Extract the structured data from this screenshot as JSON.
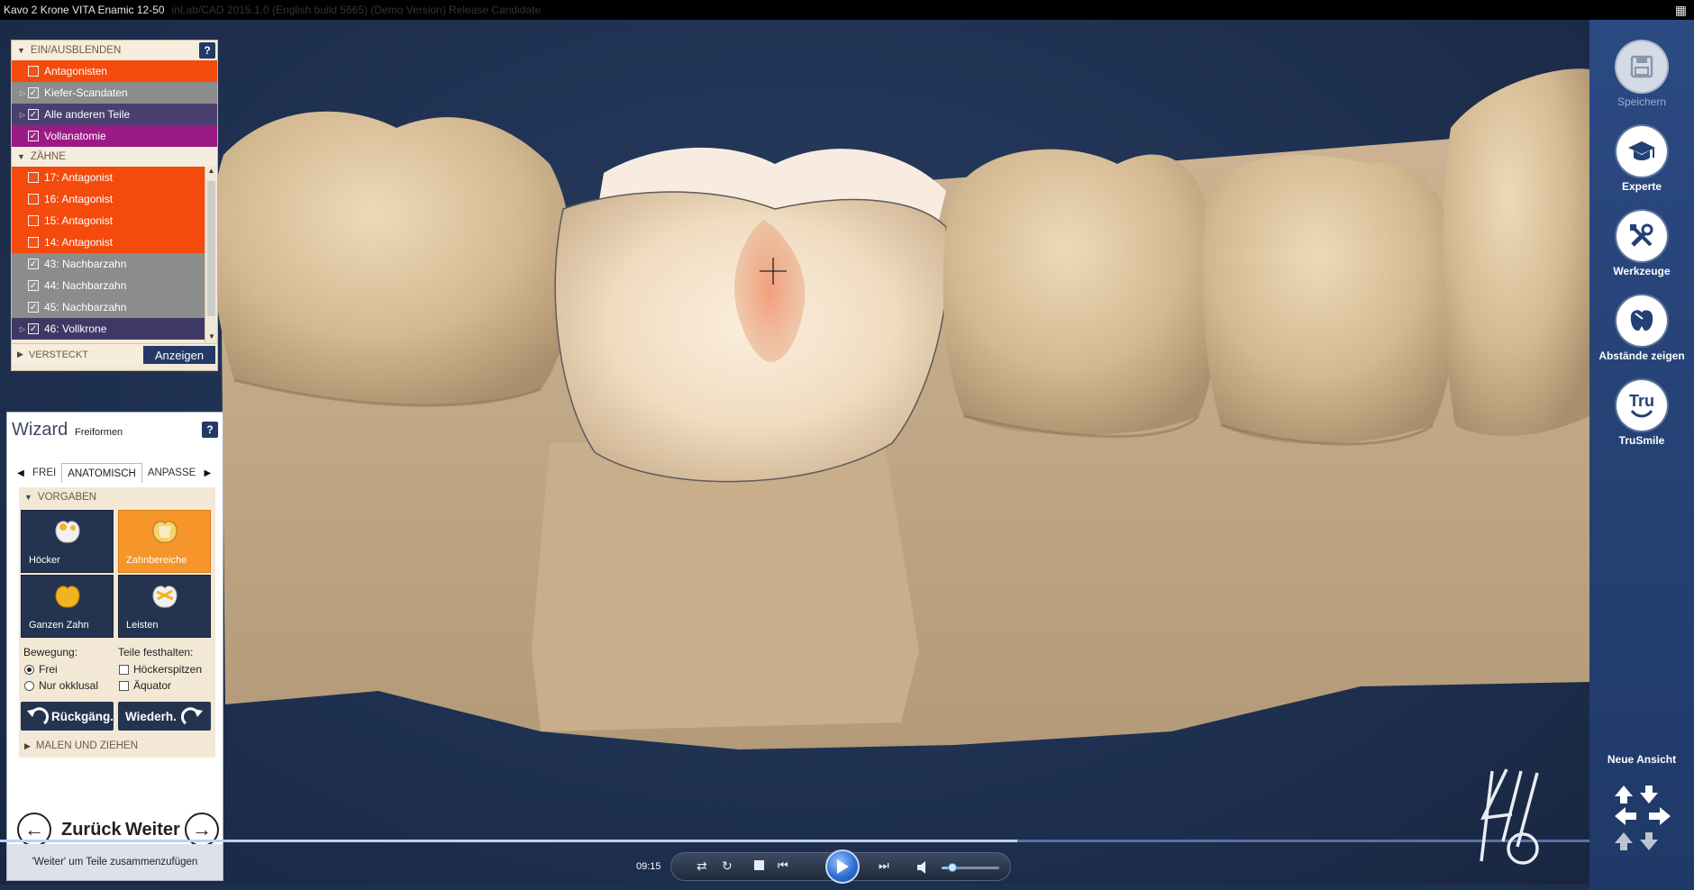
{
  "title_bar": {
    "window_title": "Kavo 2 Krone VITA Enamic  12-50",
    "ghost_text": "inLab/CAD 2015.1.0 (English build 5665) (Demo Version) Release Candidate"
  },
  "visibility_panel": {
    "header": "EIN/AUSBLENDEN",
    "help": "?",
    "items": [
      {
        "label": "Antagonisten",
        "checked": false,
        "expandable": false,
        "color": "#f44a0c"
      },
      {
        "label": "Kiefer-Scandaten",
        "checked": true,
        "expandable": true,
        "color": "#8c8c8a"
      },
      {
        "label": "Alle anderen Teile",
        "checked": true,
        "expandable": true,
        "color": "#4a3f6e"
      },
      {
        "label": "Vollanatomie",
        "checked": true,
        "expandable": false,
        "color": "#9c1a86"
      }
    ],
    "teeth_header": "ZÄHNE",
    "teeth": [
      {
        "label": "17: Antagonist",
        "checked": false,
        "expandable": false,
        "color": "#f44a0c"
      },
      {
        "label": "16: Antagonist",
        "checked": false,
        "expandable": false,
        "color": "#f44a0c"
      },
      {
        "label": "15: Antagonist",
        "checked": false,
        "expandable": false,
        "color": "#f44a0c"
      },
      {
        "label": "14: Antagonist",
        "checked": false,
        "expandable": false,
        "color": "#f44a0c"
      },
      {
        "label": "43: Nachbarzahn",
        "checked": true,
        "expandable": false,
        "color": "#8c8c8a"
      },
      {
        "label": "44: Nachbarzahn",
        "checked": true,
        "expandable": false,
        "color": "#8c8c8a"
      },
      {
        "label": "45: Nachbarzahn",
        "checked": true,
        "expandable": false,
        "color": "#8c8c8a"
      },
      {
        "label": "46: Vollkrone",
        "checked": true,
        "expandable": true,
        "color": "#3e3866"
      }
    ],
    "hidden_header": "VERSTECKT",
    "show_button": "Anzeigen"
  },
  "wizard": {
    "title": "Wizard",
    "subtitle": "Freiformen",
    "help": "?",
    "tabs": [
      "FREI",
      "ANATOMISCH",
      "ANPASSE"
    ],
    "active_tab": 1,
    "section_header": "VORGABEN",
    "tiles": [
      {
        "label": "Höcker",
        "active": false
      },
      {
        "label": "Zahnbereiche",
        "active": true
      },
      {
        "label": "Ganzen Zahn",
        "active": false
      },
      {
        "label": "Leisten",
        "active": false
      }
    ],
    "movement_label": "Bewegung:",
    "movement_options": [
      {
        "label": "Frei",
        "selected": true
      },
      {
        "label": "Nur okklusal",
        "selected": false
      }
    ],
    "hold_label": "Teile festhalten:",
    "hold_options": [
      {
        "label": "Höckerspitzen",
        "checked": false
      },
      {
        "label": "Äquator",
        "checked": false
      }
    ],
    "undo_label": "Rückgäng.",
    "redo_label": "Wiederh.",
    "paint_section": "MALEN UND ZIEHEN",
    "back_label": "Zurück",
    "next_label": "Weiter",
    "hint": "'Weiter' um Teile zusammenzufügen"
  },
  "sidebar": {
    "items": [
      {
        "label": "Speichern",
        "icon": "save-icon",
        "enabled": false
      },
      {
        "label": "Experte",
        "icon": "graduation-cap-icon",
        "enabled": true
      },
      {
        "label": "Werkzeuge",
        "icon": "tools-icon",
        "enabled": true
      },
      {
        "label": "Abstände zeigen",
        "icon": "tooth-distance-icon",
        "enabled": true
      },
      {
        "label": "TruSmile",
        "icon": "trusmile-icon",
        "enabled": true
      }
    ],
    "trusmile_glyph": "Tru",
    "new_view_label": "Neue Ansicht"
  },
  "player": {
    "time": "09:15",
    "progress": 0.64,
    "volume": 0.18
  },
  "colors": {
    "accent_navy": "#233a66",
    "active_orange": "#f5952a",
    "sidebar_blue": "#2b4a82",
    "tooth": "#d8c1a0"
  }
}
